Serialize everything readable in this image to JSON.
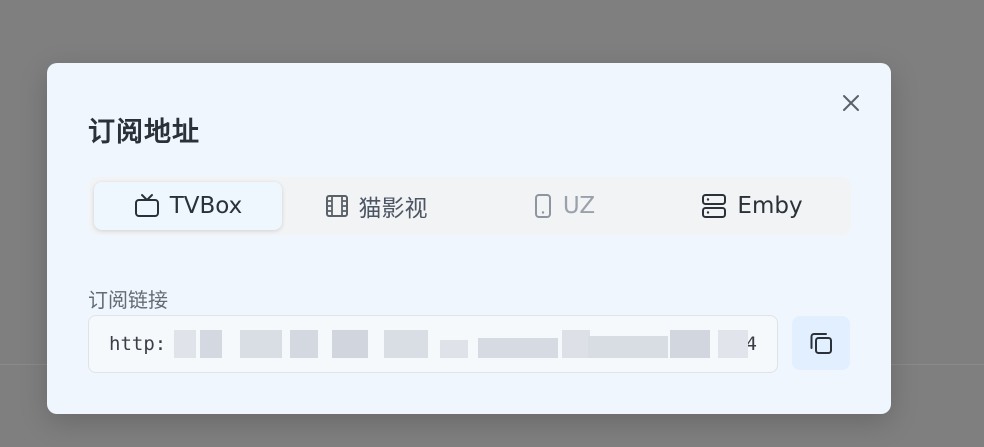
{
  "modal": {
    "title": "订阅地址",
    "close_icon": "close-icon"
  },
  "tabs": [
    {
      "label": "TVBox",
      "icon": "tv-icon",
      "active": true
    },
    {
      "label": "猫影视",
      "icon": "film-icon",
      "active": false
    },
    {
      "label": "UZ",
      "icon": "phone-icon",
      "active": false
    },
    {
      "label": "Emby",
      "icon": "server-icon",
      "active": false
    }
  ],
  "subscription": {
    "label": "订阅链接",
    "url_prefix": "http:",
    "url_suffix": "4",
    "copy_icon": "copy-icon"
  },
  "colors": {
    "overlay": "#7f7f7f",
    "modal_bg": "#eff6fe",
    "accent": "#e2efff"
  }
}
